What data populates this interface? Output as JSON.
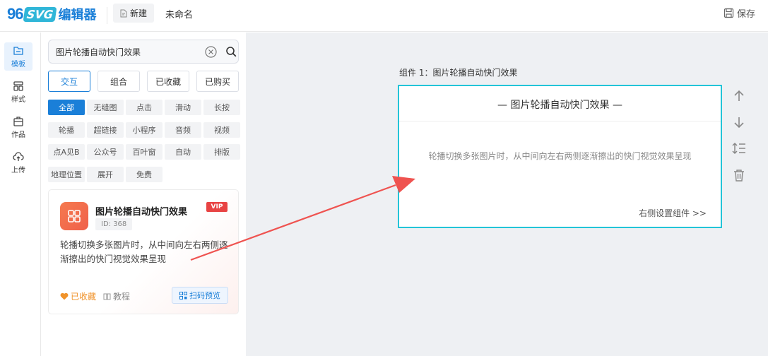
{
  "header": {
    "logo_number": "96",
    "logo_svg": "SVG",
    "logo_text": "编辑器",
    "new_label": "新建",
    "doc_name": "未命名",
    "save_label": "保存"
  },
  "rail": {
    "items": [
      {
        "label": "模板",
        "icon": "template-icon",
        "active": true
      },
      {
        "label": "样式",
        "icon": "style-icon",
        "active": false
      },
      {
        "label": "作品",
        "icon": "works-icon",
        "active": false
      },
      {
        "label": "上传",
        "icon": "upload-icon",
        "active": false
      }
    ]
  },
  "search": {
    "value": "图片轮播自动快门效果"
  },
  "tabs": [
    "交互",
    "组合",
    "已收藏",
    "已购买"
  ],
  "chips": [
    [
      "全部",
      "无缝图",
      "点击",
      "滑动",
      "长按"
    ],
    [
      "轮播",
      "超链接",
      "小程序",
      "音频",
      "视频"
    ],
    [
      "点A见B",
      "公众号",
      "百叶窗",
      "自动",
      "排版"
    ],
    [
      "地理位置",
      "展开",
      "免费"
    ]
  ],
  "card": {
    "title": "图片轮播自动快门效果",
    "vip": "VIP",
    "id": "ID: 368",
    "desc": "轮播切换多张图片时，从中间向左右两侧逐渐擦出的快门视觉效果呈现",
    "fav": "已收藏",
    "tutorial": "教程",
    "scan": "扫码预览"
  },
  "component": {
    "label": "组件 1：图片轮播自动快门效果",
    "title": "— 图片轮播自动快门效果 —",
    "desc": "轮播切换多张图片时，从中间向左右两侧逐渐擦出的快门视觉效果呈现",
    "link": "右侧设置组件 >>"
  },
  "colors": {
    "brand": "#1a7fd8",
    "component_border": "#23c4d8",
    "arrow": "#ef5350",
    "vip": "#e84343",
    "favorite": "#f0932b"
  }
}
